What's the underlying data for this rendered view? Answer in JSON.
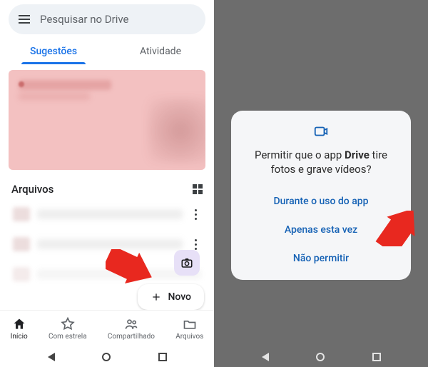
{
  "left": {
    "search": {
      "placeholder": "Pesquisar no Drive"
    },
    "tabs": {
      "suggestions": "Sugestões",
      "activity": "Atividade"
    },
    "files": {
      "header": "Arquivos"
    },
    "fab": {
      "novo": "Novo"
    },
    "nav": {
      "home": "Início",
      "starred": "Com estrela",
      "shared": "Compartilhado",
      "files": "Arquivos"
    }
  },
  "right": {
    "dialog": {
      "title_pre": "Permitir que o app ",
      "title_app": "Drive",
      "title_post": " tire fotos e grave vídeos?",
      "options": {
        "while": "Durante o uso do app",
        "once": "Apenas esta vez",
        "deny": "Não permitir"
      }
    }
  },
  "colors": {
    "accent": "#1a73e8",
    "dialog_link": "#1662b5"
  }
}
